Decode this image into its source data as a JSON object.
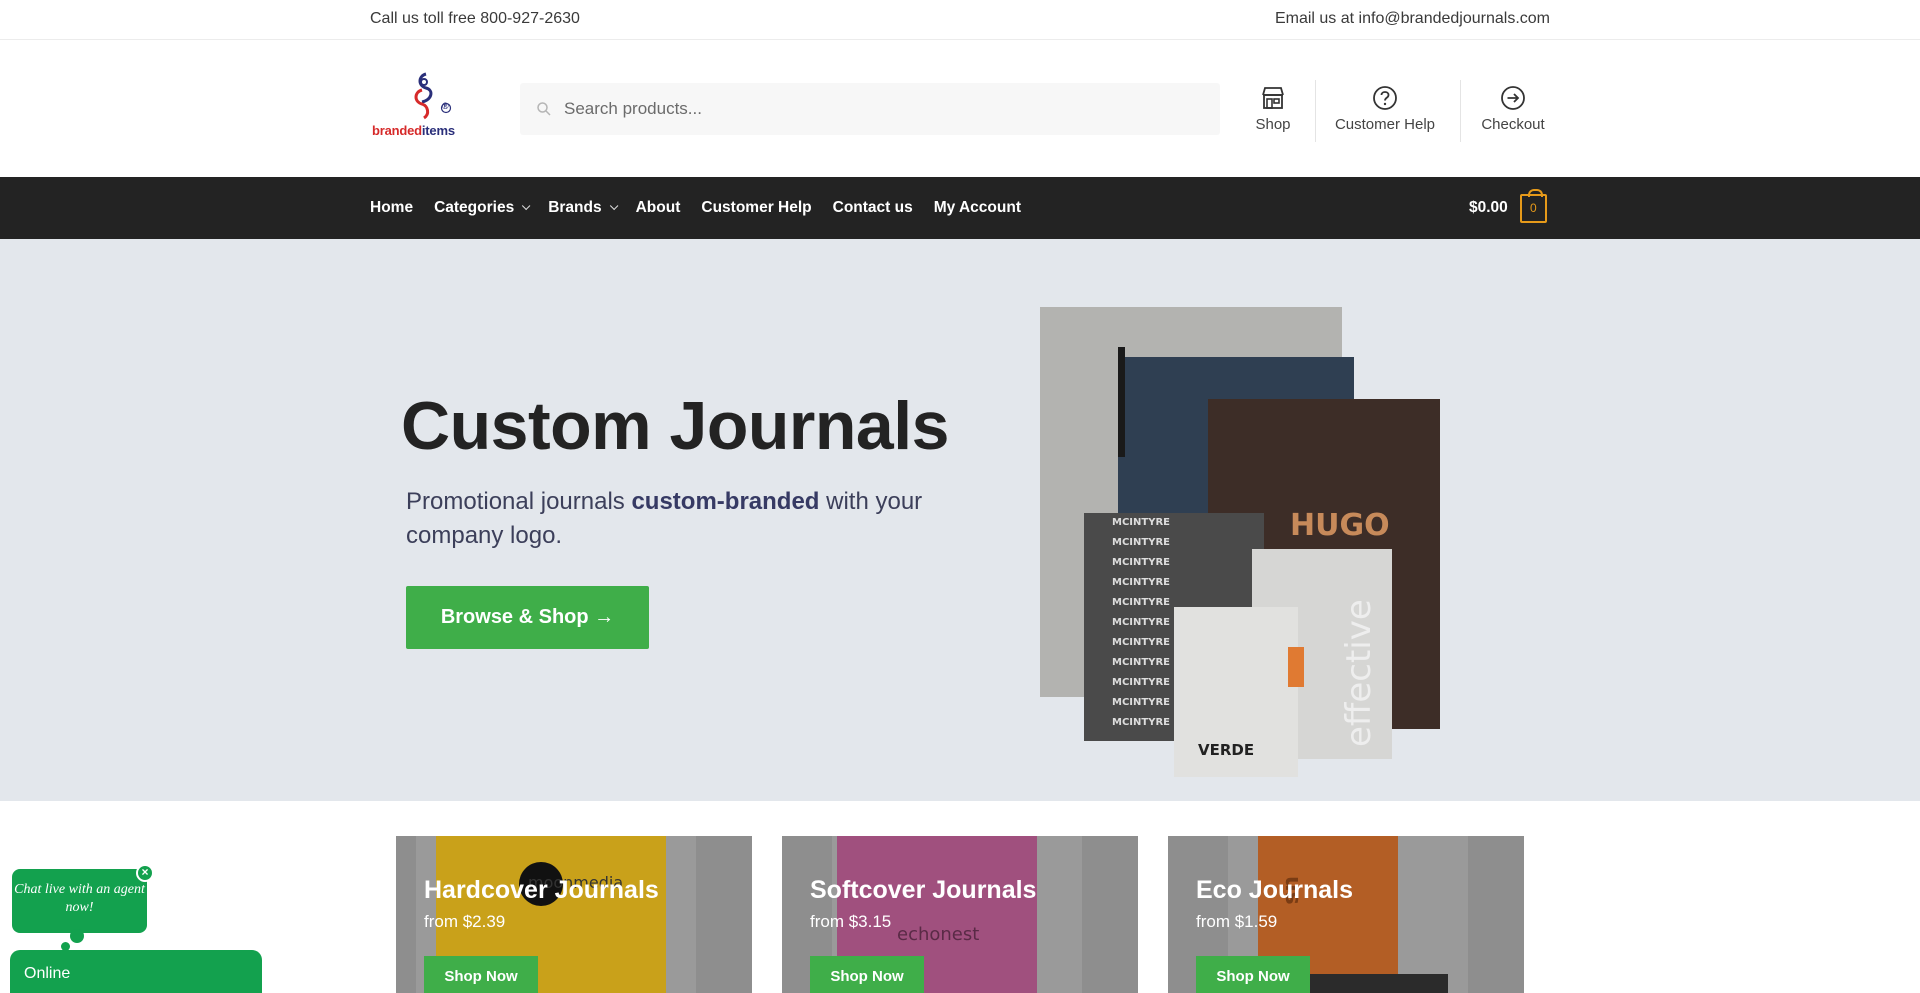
{
  "topbar": {
    "phone": "Call us toll free 800-927-2630",
    "email": "Email us at info@brandedjournals.com"
  },
  "header": {
    "logo": {
      "text_a": "branded",
      "text_b": "items",
      "reg": "®"
    },
    "search": {
      "placeholder": "Search products..."
    },
    "links": [
      {
        "label": "Shop",
        "icon": "store-icon"
      },
      {
        "label": "Customer Help",
        "icon": "help-circle-icon"
      },
      {
        "label": "Checkout",
        "icon": "arrow-circle-right-icon"
      }
    ]
  },
  "nav": {
    "items": [
      {
        "label": "Home",
        "dropdown": false
      },
      {
        "label": "Categories",
        "dropdown": true
      },
      {
        "label": "Brands",
        "dropdown": true
      },
      {
        "label": "About",
        "dropdown": false
      },
      {
        "label": "Customer Help",
        "dropdown": false
      },
      {
        "label": "Contact us",
        "dropdown": false
      },
      {
        "label": "My Account",
        "dropdown": false
      }
    ],
    "cart": {
      "amount": "$0.00",
      "count": "0"
    }
  },
  "hero": {
    "title": "Custom Journals",
    "subtitle_pre": "Promotional journals ",
    "subtitle_bold": "custom-branded",
    "subtitle_post": " with your company logo.",
    "cta": "Browse & Shop →",
    "product_texts": {
      "hugo": "HUGO",
      "effective": "effective",
      "verde": "VERDE",
      "mcintyre": "MCINTYRE"
    }
  },
  "cards": [
    {
      "title": "Hardcover Journals",
      "price": "from $2.39",
      "button": "Shop Now",
      "art_text": "moonmedia"
    },
    {
      "title": "Softcover Journals",
      "price": "from $3.15",
      "button": "Shop Now",
      "art_text": "echonest"
    },
    {
      "title": "Eco Journals",
      "price": "from $1.59",
      "button": "Shop Now",
      "art_text": "us"
    }
  ],
  "chat": {
    "bubble": "Chat live with an agent now!",
    "close": "×",
    "status": "Online"
  },
  "colors": {
    "nav_bg": "#232323",
    "hero_bg": "#e3e7ec",
    "cta_green": "#3fae49",
    "chat_green": "#13a14e",
    "cart_accent": "#e69a1a"
  }
}
